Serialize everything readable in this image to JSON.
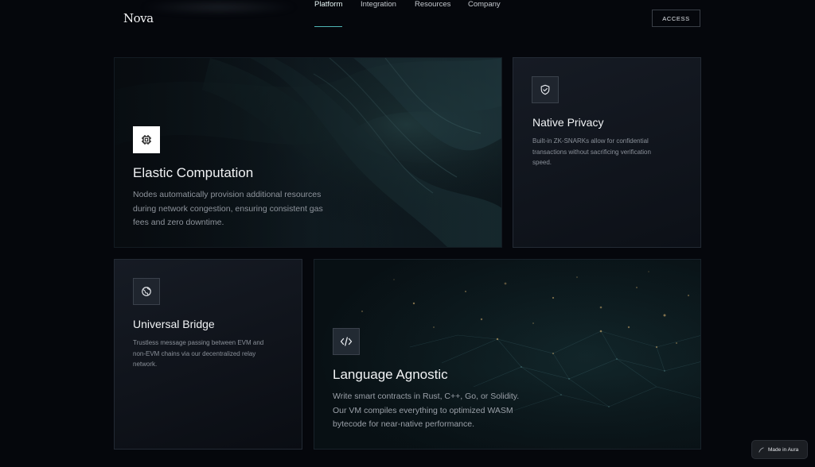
{
  "header": {
    "logo": "Nova",
    "nav": [
      {
        "label": "Platform",
        "active": true
      },
      {
        "label": "Integration",
        "active": false
      },
      {
        "label": "Resources",
        "active": false
      },
      {
        "label": "Company",
        "active": false
      }
    ],
    "access_label": "ACCESS"
  },
  "cards": {
    "elastic": {
      "icon": "cpu-icon",
      "title": "Elastic Computation",
      "desc": [
        "Nodes automatically provision additional resources",
        "during network congestion, ensuring consistent gas",
        "fees and zero downtime."
      ]
    },
    "privacy": {
      "icon": "shield-check-icon",
      "title": "Native Privacy",
      "desc": [
        "Built-in ZK-SNARKs allow for confidential",
        "transactions without sacrificing verification",
        "speed."
      ]
    },
    "bridge": {
      "icon": "globe-icon",
      "title": "Universal Bridge",
      "desc": [
        "Trustless message passing between EVM and",
        "non-EVM chains via our decentralized relay",
        "network."
      ]
    },
    "language": {
      "icon": "code-icon",
      "title": "Language Agnostic",
      "desc": [
        "Write smart contracts in Rust, C++, Go, or Solidity.",
        "Our VM compiles everything to optimized WASM",
        "bytecode for near-native performance."
      ]
    }
  },
  "badge": {
    "label": "Made in Aura"
  },
  "colors": {
    "background": "#05070c",
    "accent": "#4fb5b5",
    "card_border": "#232a34"
  }
}
